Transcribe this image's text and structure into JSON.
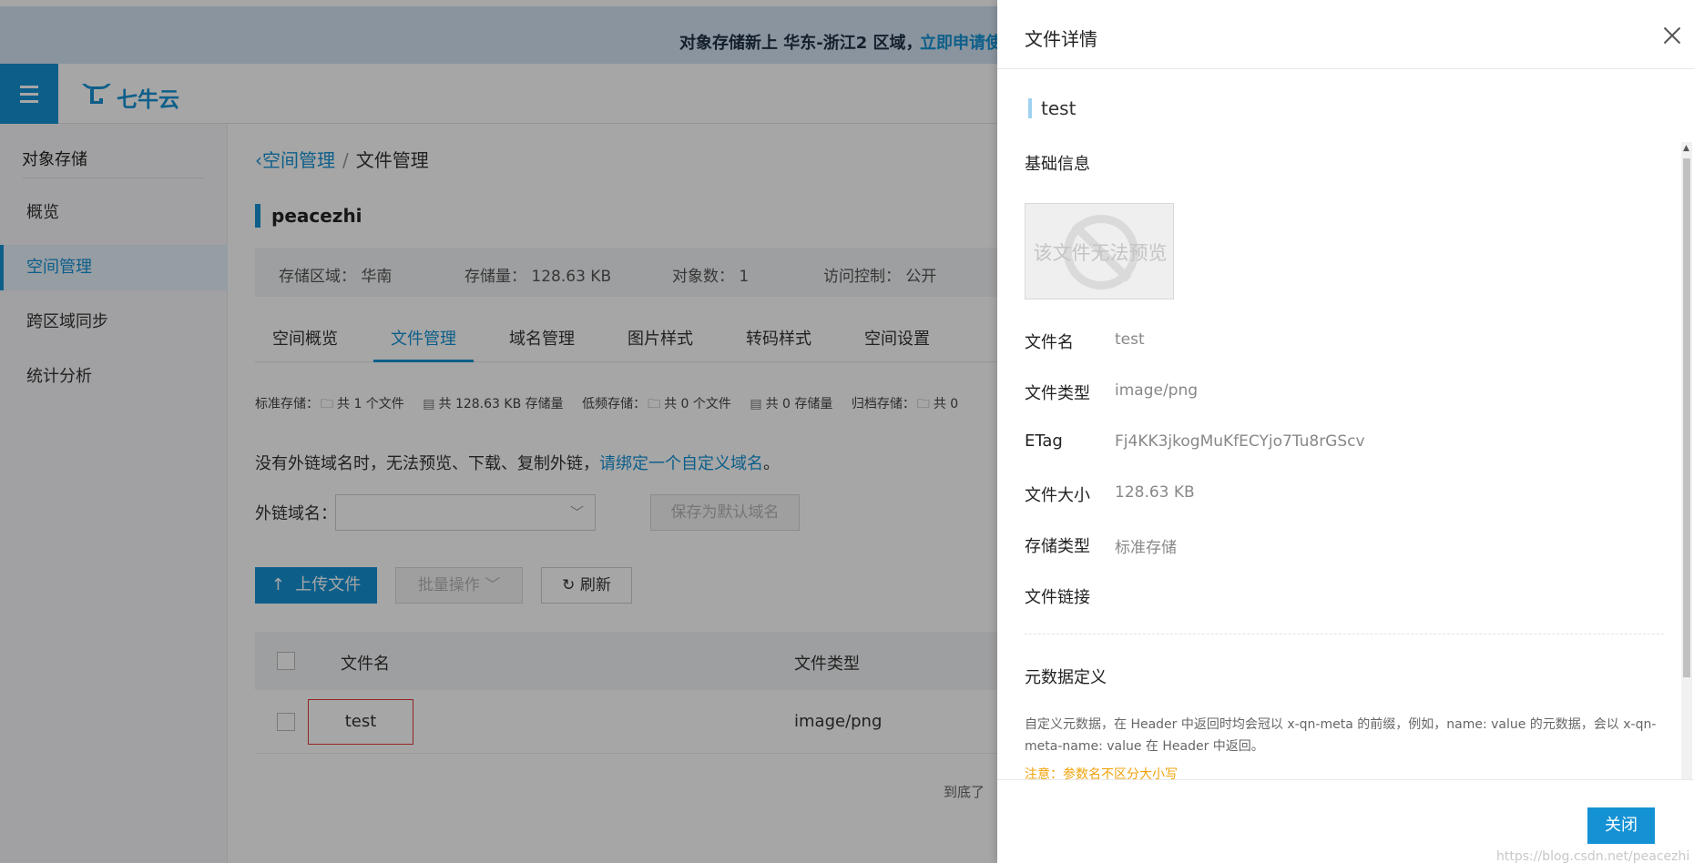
{
  "banner": {
    "text": "对象存储新上 华东-浙江2 区域，",
    "link": "立即申请使"
  },
  "header": {
    "logo_text": "七牛云",
    "menu_icon": "hamburger-icon"
  },
  "sidebar": {
    "title": "对象存储",
    "items": [
      {
        "label": "概览"
      },
      {
        "label": "空间管理",
        "active": true
      },
      {
        "label": "跨区域同步"
      },
      {
        "label": "统计分析"
      }
    ]
  },
  "breadcrumb": {
    "back": "空间管理",
    "separator": "/",
    "current": "文件管理"
  },
  "bucket": {
    "name": "peacezhi",
    "region": "存储区域：  华南",
    "size": "存储量：  128.63 KB",
    "objects": "对象数：  1",
    "access": "访问控制：  公开"
  },
  "tabs": [
    "空间概览",
    "文件管理",
    "域名管理",
    "图片样式",
    "转码样式",
    "空间设置"
  ],
  "storage_summary": {
    "std_label": "标准存储：",
    "std_files": "共 1 个文件",
    "std_size": "共 128.63 KB 存储量",
    "ia_label": "低频存储：",
    "ia_files": "共 0 个文件",
    "ia_size": "共 0 存储量",
    "archive_label": "归档存储：",
    "archive_files": "共 0"
  },
  "notice": {
    "text": "没有外链域名时，无法预览、下载、复制外链，",
    "link": "请绑定一个自定义域名",
    "end": "。"
  },
  "domain": {
    "label": "外链域名：",
    "value": "",
    "save_default": "保存为默认域名"
  },
  "toolbar": {
    "upload": "上传文件",
    "batch": "批量操作",
    "refresh": "刷新"
  },
  "table": {
    "headers": [
      "文件名",
      "文件类型"
    ],
    "rows": [
      {
        "name": "test",
        "type": "image/png"
      }
    ],
    "end_text": "到底了"
  },
  "drawer": {
    "title": "文件详情",
    "file_name": "test",
    "basic_title": "基础信息",
    "preview_text": "该文件无法预览",
    "fields": [
      {
        "label": "文件名",
        "value": "test"
      },
      {
        "label": "文件类型",
        "value": "image/png"
      },
      {
        "label": "ETag",
        "value": "Fj4KK3jkogMuKfECYjo7Tu8rGScv"
      },
      {
        "label": "文件大小",
        "value": "128.63 KB"
      },
      {
        "label": "存储类型",
        "value": "标准存储"
      },
      {
        "label": "文件链接",
        "value": ""
      }
    ],
    "meta_title": "元数据定义",
    "meta_desc": "自定义元数据，在 Header 中返回时均会冠以 x-qn-meta 的前缀，例如，name: value 的元数据，会以 x-qn-meta-name: value 在 Header 中返回。",
    "meta_note": "注意：参数名不区分大小写",
    "close_button": "关闭"
  },
  "watermark": "https://blog.csdn.net/peacezhi",
  "colors": {
    "accent": "#1592d4",
    "warning": "#f0a30a",
    "highlight_border": "#e23a3a"
  }
}
